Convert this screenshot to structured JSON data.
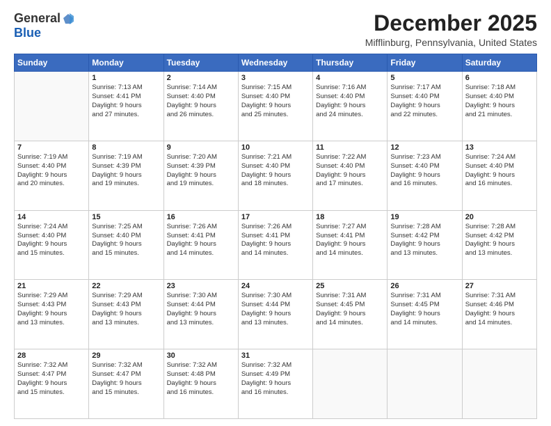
{
  "logo": {
    "general": "General",
    "blue": "Blue"
  },
  "title": "December 2025",
  "location": "Mifflinburg, Pennsylvania, United States",
  "days_header": [
    "Sunday",
    "Monday",
    "Tuesday",
    "Wednesday",
    "Thursday",
    "Friday",
    "Saturday"
  ],
  "weeks": [
    [
      {
        "day": "",
        "info": ""
      },
      {
        "day": "1",
        "info": "Sunrise: 7:13 AM\nSunset: 4:41 PM\nDaylight: 9 hours\nand 27 minutes."
      },
      {
        "day": "2",
        "info": "Sunrise: 7:14 AM\nSunset: 4:40 PM\nDaylight: 9 hours\nand 26 minutes."
      },
      {
        "day": "3",
        "info": "Sunrise: 7:15 AM\nSunset: 4:40 PM\nDaylight: 9 hours\nand 25 minutes."
      },
      {
        "day": "4",
        "info": "Sunrise: 7:16 AM\nSunset: 4:40 PM\nDaylight: 9 hours\nand 24 minutes."
      },
      {
        "day": "5",
        "info": "Sunrise: 7:17 AM\nSunset: 4:40 PM\nDaylight: 9 hours\nand 22 minutes."
      },
      {
        "day": "6",
        "info": "Sunrise: 7:18 AM\nSunset: 4:40 PM\nDaylight: 9 hours\nand 21 minutes."
      }
    ],
    [
      {
        "day": "7",
        "info": "Sunrise: 7:19 AM\nSunset: 4:40 PM\nDaylight: 9 hours\nand 20 minutes."
      },
      {
        "day": "8",
        "info": "Sunrise: 7:19 AM\nSunset: 4:39 PM\nDaylight: 9 hours\nand 19 minutes."
      },
      {
        "day": "9",
        "info": "Sunrise: 7:20 AM\nSunset: 4:39 PM\nDaylight: 9 hours\nand 19 minutes."
      },
      {
        "day": "10",
        "info": "Sunrise: 7:21 AM\nSunset: 4:40 PM\nDaylight: 9 hours\nand 18 minutes."
      },
      {
        "day": "11",
        "info": "Sunrise: 7:22 AM\nSunset: 4:40 PM\nDaylight: 9 hours\nand 17 minutes."
      },
      {
        "day": "12",
        "info": "Sunrise: 7:23 AM\nSunset: 4:40 PM\nDaylight: 9 hours\nand 16 minutes."
      },
      {
        "day": "13",
        "info": "Sunrise: 7:24 AM\nSunset: 4:40 PM\nDaylight: 9 hours\nand 16 minutes."
      }
    ],
    [
      {
        "day": "14",
        "info": "Sunrise: 7:24 AM\nSunset: 4:40 PM\nDaylight: 9 hours\nand 15 minutes."
      },
      {
        "day": "15",
        "info": "Sunrise: 7:25 AM\nSunset: 4:40 PM\nDaylight: 9 hours\nand 15 minutes."
      },
      {
        "day": "16",
        "info": "Sunrise: 7:26 AM\nSunset: 4:41 PM\nDaylight: 9 hours\nand 14 minutes."
      },
      {
        "day": "17",
        "info": "Sunrise: 7:26 AM\nSunset: 4:41 PM\nDaylight: 9 hours\nand 14 minutes."
      },
      {
        "day": "18",
        "info": "Sunrise: 7:27 AM\nSunset: 4:41 PM\nDaylight: 9 hours\nand 14 minutes."
      },
      {
        "day": "19",
        "info": "Sunrise: 7:28 AM\nSunset: 4:42 PM\nDaylight: 9 hours\nand 13 minutes."
      },
      {
        "day": "20",
        "info": "Sunrise: 7:28 AM\nSunset: 4:42 PM\nDaylight: 9 hours\nand 13 minutes."
      }
    ],
    [
      {
        "day": "21",
        "info": "Sunrise: 7:29 AM\nSunset: 4:43 PM\nDaylight: 9 hours\nand 13 minutes."
      },
      {
        "day": "22",
        "info": "Sunrise: 7:29 AM\nSunset: 4:43 PM\nDaylight: 9 hours\nand 13 minutes."
      },
      {
        "day": "23",
        "info": "Sunrise: 7:30 AM\nSunset: 4:44 PM\nDaylight: 9 hours\nand 13 minutes."
      },
      {
        "day": "24",
        "info": "Sunrise: 7:30 AM\nSunset: 4:44 PM\nDaylight: 9 hours\nand 13 minutes."
      },
      {
        "day": "25",
        "info": "Sunrise: 7:31 AM\nSunset: 4:45 PM\nDaylight: 9 hours\nand 14 minutes."
      },
      {
        "day": "26",
        "info": "Sunrise: 7:31 AM\nSunset: 4:45 PM\nDaylight: 9 hours\nand 14 minutes."
      },
      {
        "day": "27",
        "info": "Sunrise: 7:31 AM\nSunset: 4:46 PM\nDaylight: 9 hours\nand 14 minutes."
      }
    ],
    [
      {
        "day": "28",
        "info": "Sunrise: 7:32 AM\nSunset: 4:47 PM\nDaylight: 9 hours\nand 15 minutes."
      },
      {
        "day": "29",
        "info": "Sunrise: 7:32 AM\nSunset: 4:47 PM\nDaylight: 9 hours\nand 15 minutes."
      },
      {
        "day": "30",
        "info": "Sunrise: 7:32 AM\nSunset: 4:48 PM\nDaylight: 9 hours\nand 16 minutes."
      },
      {
        "day": "31",
        "info": "Sunrise: 7:32 AM\nSunset: 4:49 PM\nDaylight: 9 hours\nand 16 minutes."
      },
      {
        "day": "",
        "info": ""
      },
      {
        "day": "",
        "info": ""
      },
      {
        "day": "",
        "info": ""
      }
    ]
  ]
}
